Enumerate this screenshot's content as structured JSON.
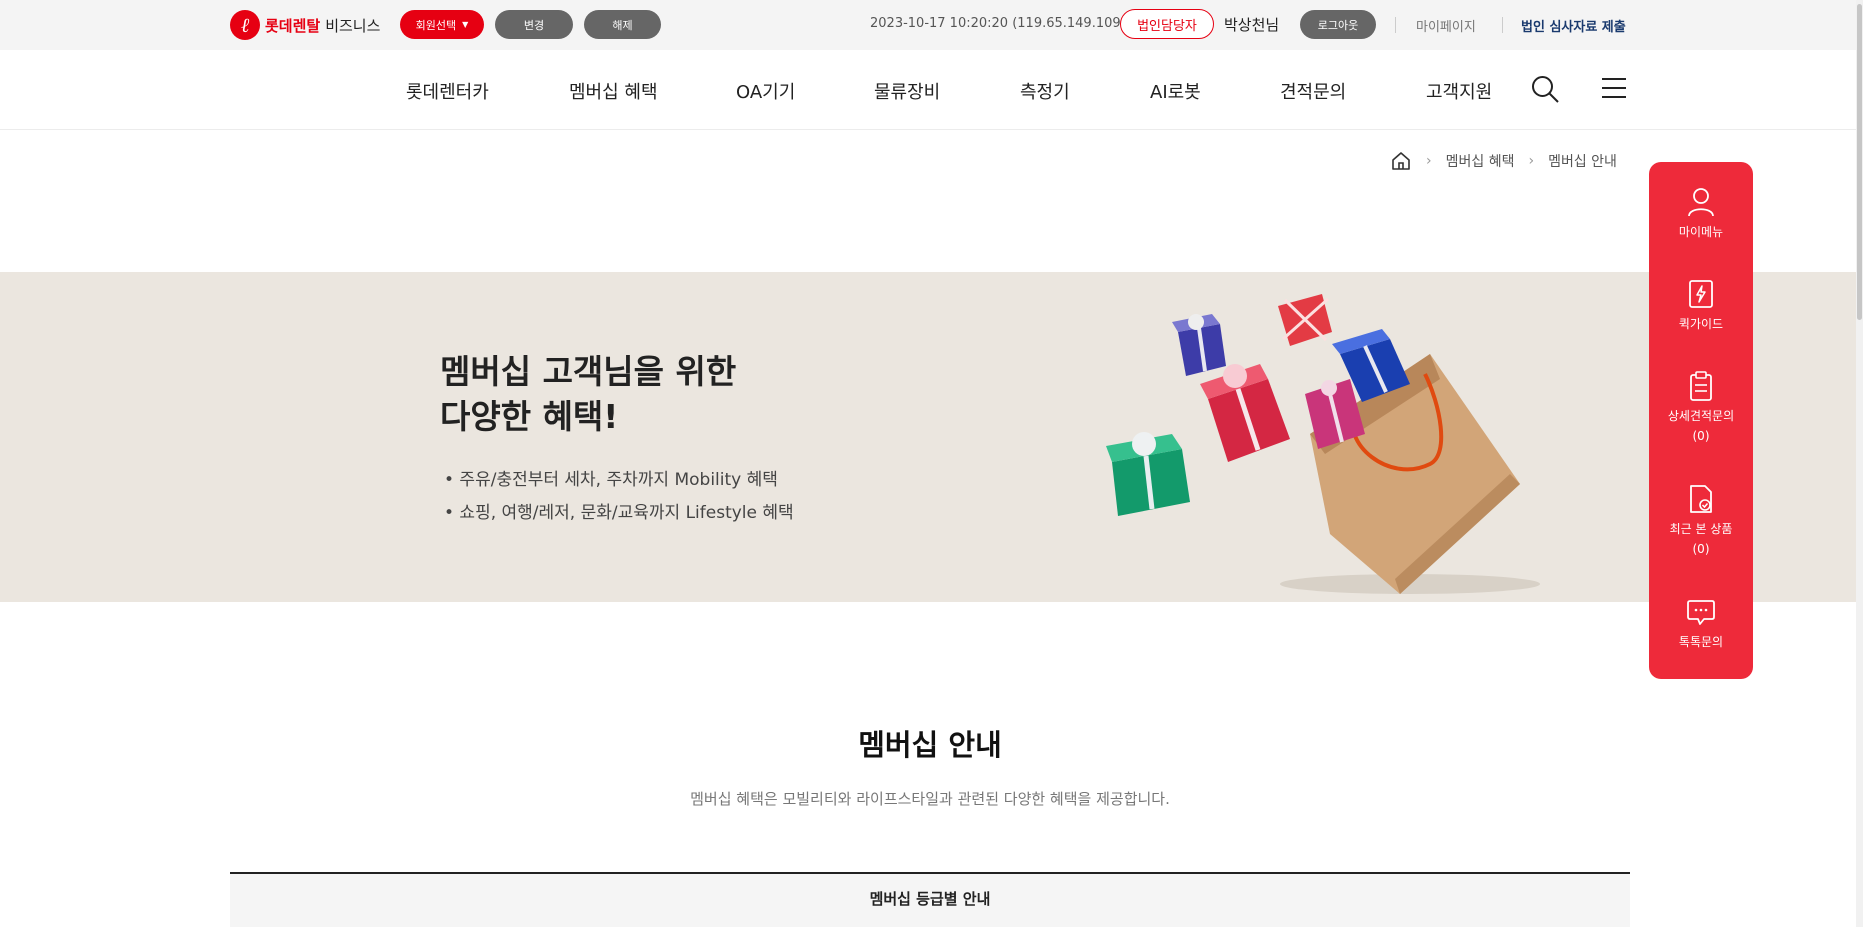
{
  "topbar": {
    "logo_brand": "롯데렌탈",
    "logo_biz": "비즈니스",
    "member_select": "회원선택",
    "change": "변경",
    "release": "해제",
    "datetime": "2023-10-17 10:20:20 (119.65.149.109)",
    "corp_manager": "법인담당자",
    "username": "박상천님",
    "logout": "로그아웃",
    "mypage": "마이페이지",
    "corp_submit": "법인 심사자료 제출"
  },
  "nav": {
    "items": [
      "롯데렌터카",
      "멤버십 혜택",
      "OA기기",
      "물류장비",
      "측정기",
      "AI로봇",
      "견적문의",
      "고객지원"
    ]
  },
  "breadcrumb": {
    "items": [
      "멤버십 혜택",
      "멤버십 안내"
    ]
  },
  "banner": {
    "title_line1": "멤버십 고객님을 위한",
    "title_line2": "다양한 혜택!",
    "bullets": [
      "• 주유/충전부터 세차, 주차까지 Mobility 혜택",
      "• 쇼핑, 여행/레저, 문화/교육까지 Lifestyle 혜택"
    ]
  },
  "quick_menu": {
    "items": [
      {
        "label": "마이메뉴",
        "count": ""
      },
      {
        "label": "퀵가이드",
        "count": ""
      },
      {
        "label": "상세견적문의",
        "count": "(0)"
      },
      {
        "label": "최근 본 상품",
        "count": "(0)"
      },
      {
        "label": "톡톡문의",
        "count": ""
      }
    ]
  },
  "section": {
    "title": "멤버십 안내",
    "desc": "멤버십 혜택은 모빌리티와 라이프스타일과 관련된 다양한 혜택을 제공합니다.",
    "grade_label": "멤버십 등급별 안내"
  },
  "colors": {
    "brand_red": "#e60012",
    "quick_red": "#ee2a3a",
    "banner_bg": "#ebe6df",
    "corp_navy": "#1a3a6e"
  }
}
